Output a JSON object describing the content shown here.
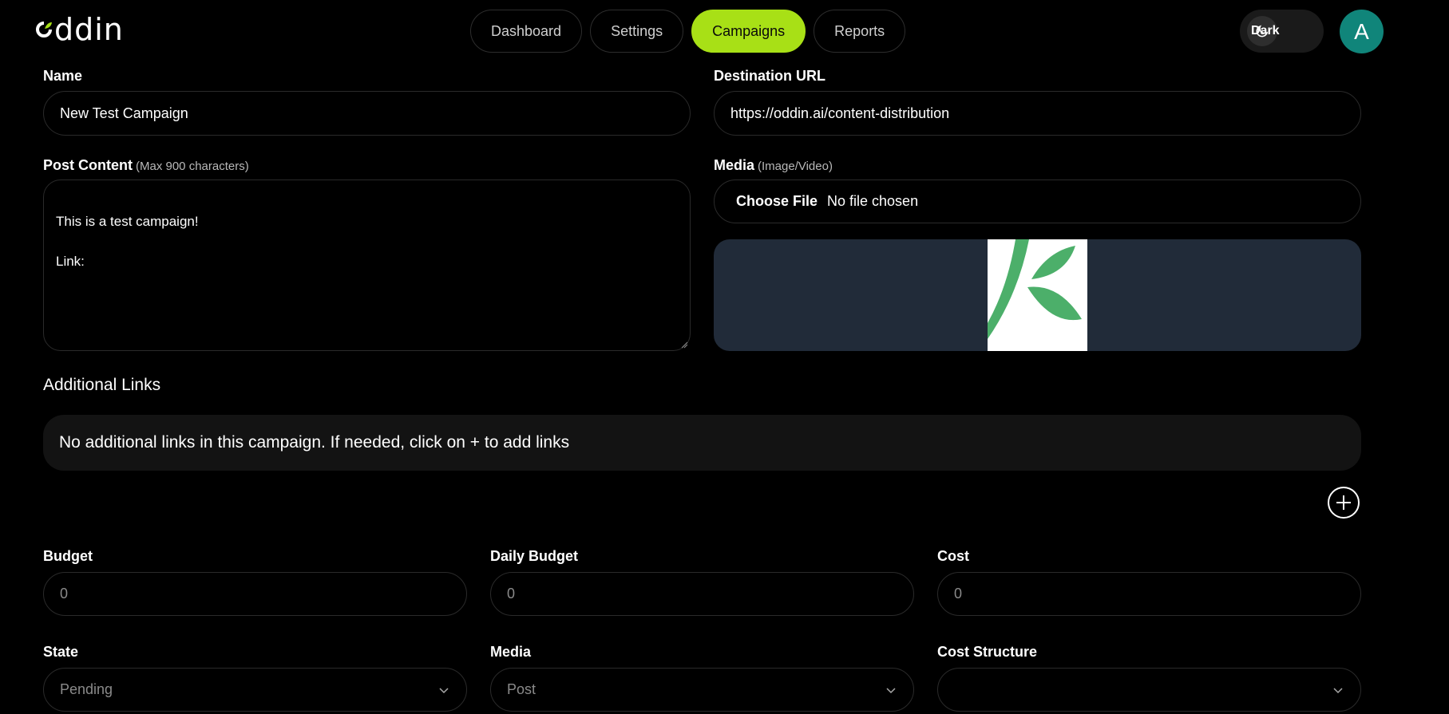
{
  "brand": {
    "logo_text": "ddin"
  },
  "nav": {
    "tabs": [
      {
        "label": "Dashboard",
        "active": false
      },
      {
        "label": "Settings",
        "active": false
      },
      {
        "label": "Campaigns",
        "active": true
      },
      {
        "label": "Reports",
        "active": false
      }
    ]
  },
  "theme": {
    "label": "Dark",
    "icon": "moon-icon"
  },
  "user": {
    "avatar_letter": "A",
    "avatar_color": "#10857a"
  },
  "form": {
    "name": {
      "label": "Name",
      "value": "New Test Campaign"
    },
    "destination_url": {
      "label": "Destination URL",
      "value": "https://oddin.ai/content-distribution"
    },
    "post_content": {
      "label": "Post Content",
      "hint": "(Max 900 characters)",
      "value": "This is a test campaign!\n\nLink:"
    },
    "media_upload": {
      "label": "Media",
      "hint": "(Image/Video)",
      "button": "Choose File",
      "status": "No file chosen"
    },
    "additional_links": {
      "title": "Additional Links",
      "empty_message": "No additional links in this campaign. If needed, click on + to add links"
    },
    "budget": {
      "label": "Budget",
      "value": "0"
    },
    "daily_budget": {
      "label": "Daily Budget",
      "value": "0"
    },
    "cost": {
      "label": "Cost",
      "value": "0"
    },
    "state": {
      "label": "State",
      "value": "Pending"
    },
    "media_type": {
      "label": "Media",
      "value": "Post"
    },
    "cost_structure": {
      "label": "Cost Structure",
      "value": ""
    }
  },
  "colors": {
    "accent": "#a8e016",
    "preview_bg": "#212b39",
    "leaf_green": "#4caf6a"
  }
}
